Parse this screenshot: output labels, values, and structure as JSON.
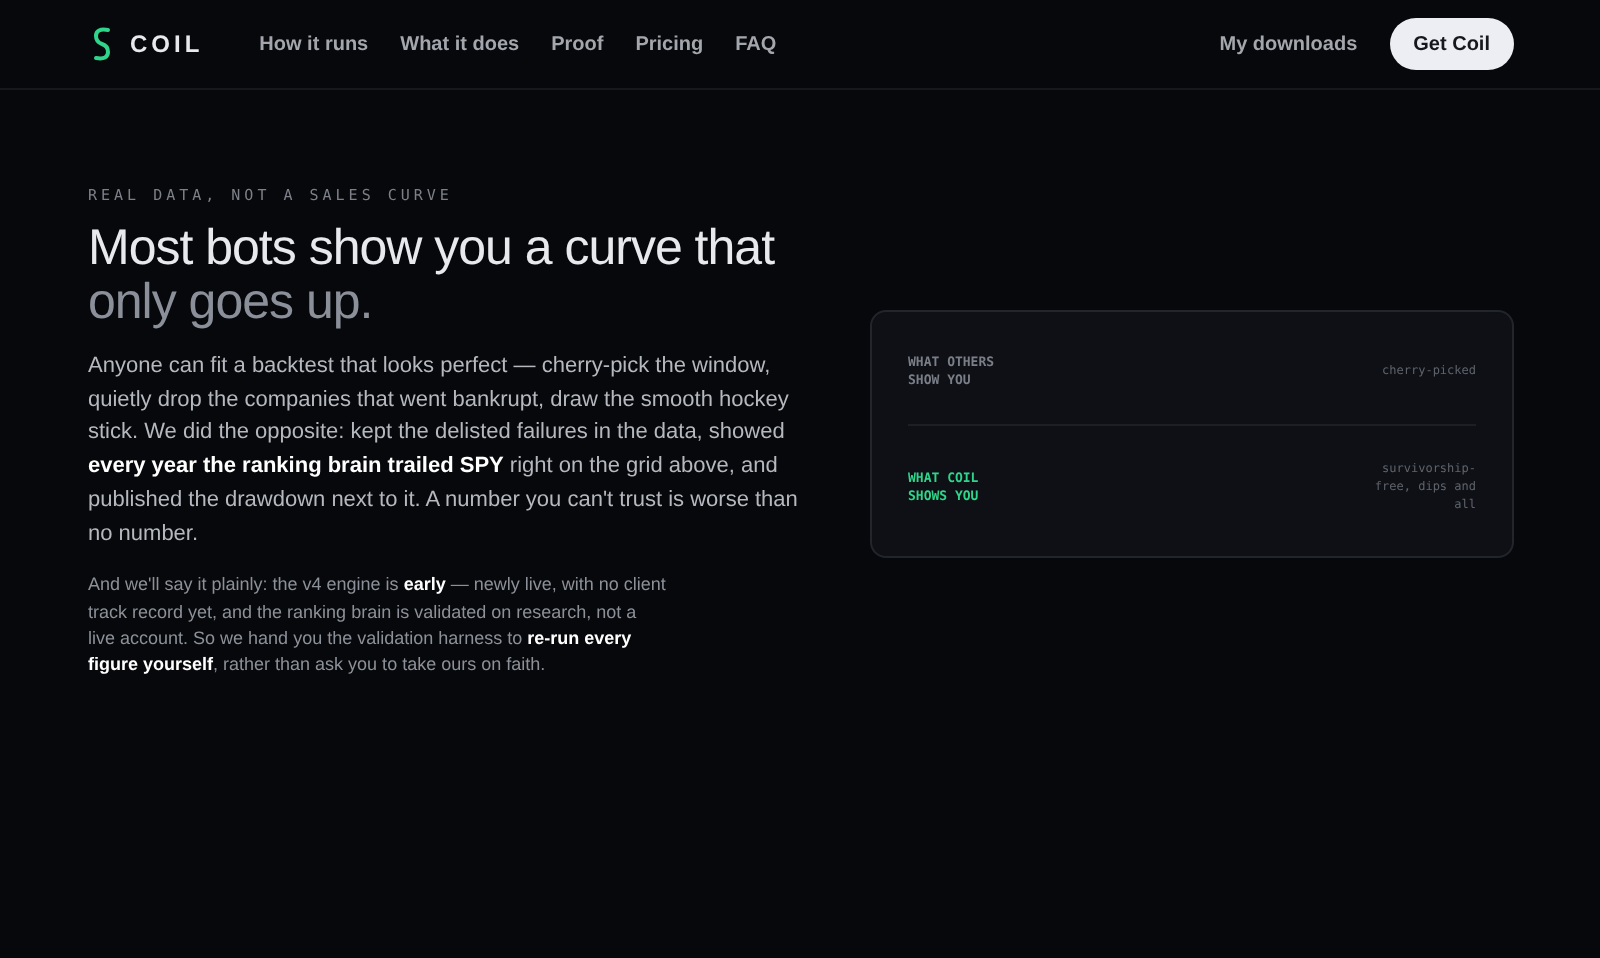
{
  "nav": {
    "brand": "COIL",
    "links": [
      "How it runs",
      "What it does",
      "Proof",
      "Pricing",
      "FAQ"
    ],
    "secondary_link": "My downloads",
    "cta": "Get Coil"
  },
  "hero": {
    "eyebrow": "REAL DATA, NOT A SALES CURVE",
    "headline": "Most bots show you a curve that",
    "headline_muted": "only goes up.",
    "body": "Anyone can fit a backtest that looks perfect — cherry-pick the window, quietly drop the companies that went bankrupt, draw the smooth hockey stick. We did the opposite: kept the delisted failures in the data, showed **every year the ranking brain trailed SPY** right on the grid above, and published the drawdown next to it. A number you can't trust is worse than no number.",
    "note": "And we'll say it plainly: the v4 engine is **early** — newly live, with no client track record yet, and the ranking brain is validated on research, not a live account. So we hand you the validation harness to **re-run every figure yourself**, rather than ask you to take ours on faith."
  },
  "comparison": [
    {
      "kind": "others",
      "label": "WHAT OTHERS SHOW YOU",
      "note": "cherry-picked"
    },
    {
      "kind": "coil",
      "label": "WHAT COIL SHOWS YOU",
      "note": "survivorship-free, dips and all"
    }
  ]
}
